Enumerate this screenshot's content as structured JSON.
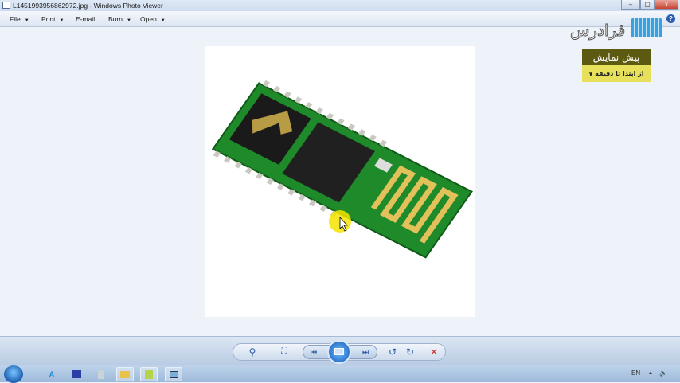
{
  "window": {
    "title": "L1451993956862972.jpg - Windows Photo Viewer",
    "minimize": "–",
    "maximize": "▢",
    "close": "x"
  },
  "menu": [
    {
      "label": "File",
      "dropdown": true
    },
    {
      "label": "Print",
      "dropdown": true
    },
    {
      "label": "E-mail",
      "dropdown": false
    },
    {
      "label": "Burn",
      "dropdown": true
    },
    {
      "label": "Open",
      "dropdown": true
    }
  ],
  "help": "?",
  "overlay": {
    "logo_text": "فرادرس",
    "badge_title": "پیش نمایش",
    "badge_subtitle": "از ابتدا تا دقیقه ۷"
  },
  "controls": {
    "zoom": "⚲",
    "fit": "⛶",
    "prev": "⏮",
    "next": "⏭",
    "rotate_ccw": "↺",
    "rotate_cw": "↻",
    "delete": "✕"
  },
  "tray": {
    "lang": "EN",
    "up": "▲",
    "volume": "🔈"
  },
  "colors": {
    "accent": "#2a5aa8",
    "badge_dark": "#5b5a10",
    "badge_light": "#e6e05a",
    "pcb": "#1f8a2a",
    "gold": "#e3c15a"
  }
}
